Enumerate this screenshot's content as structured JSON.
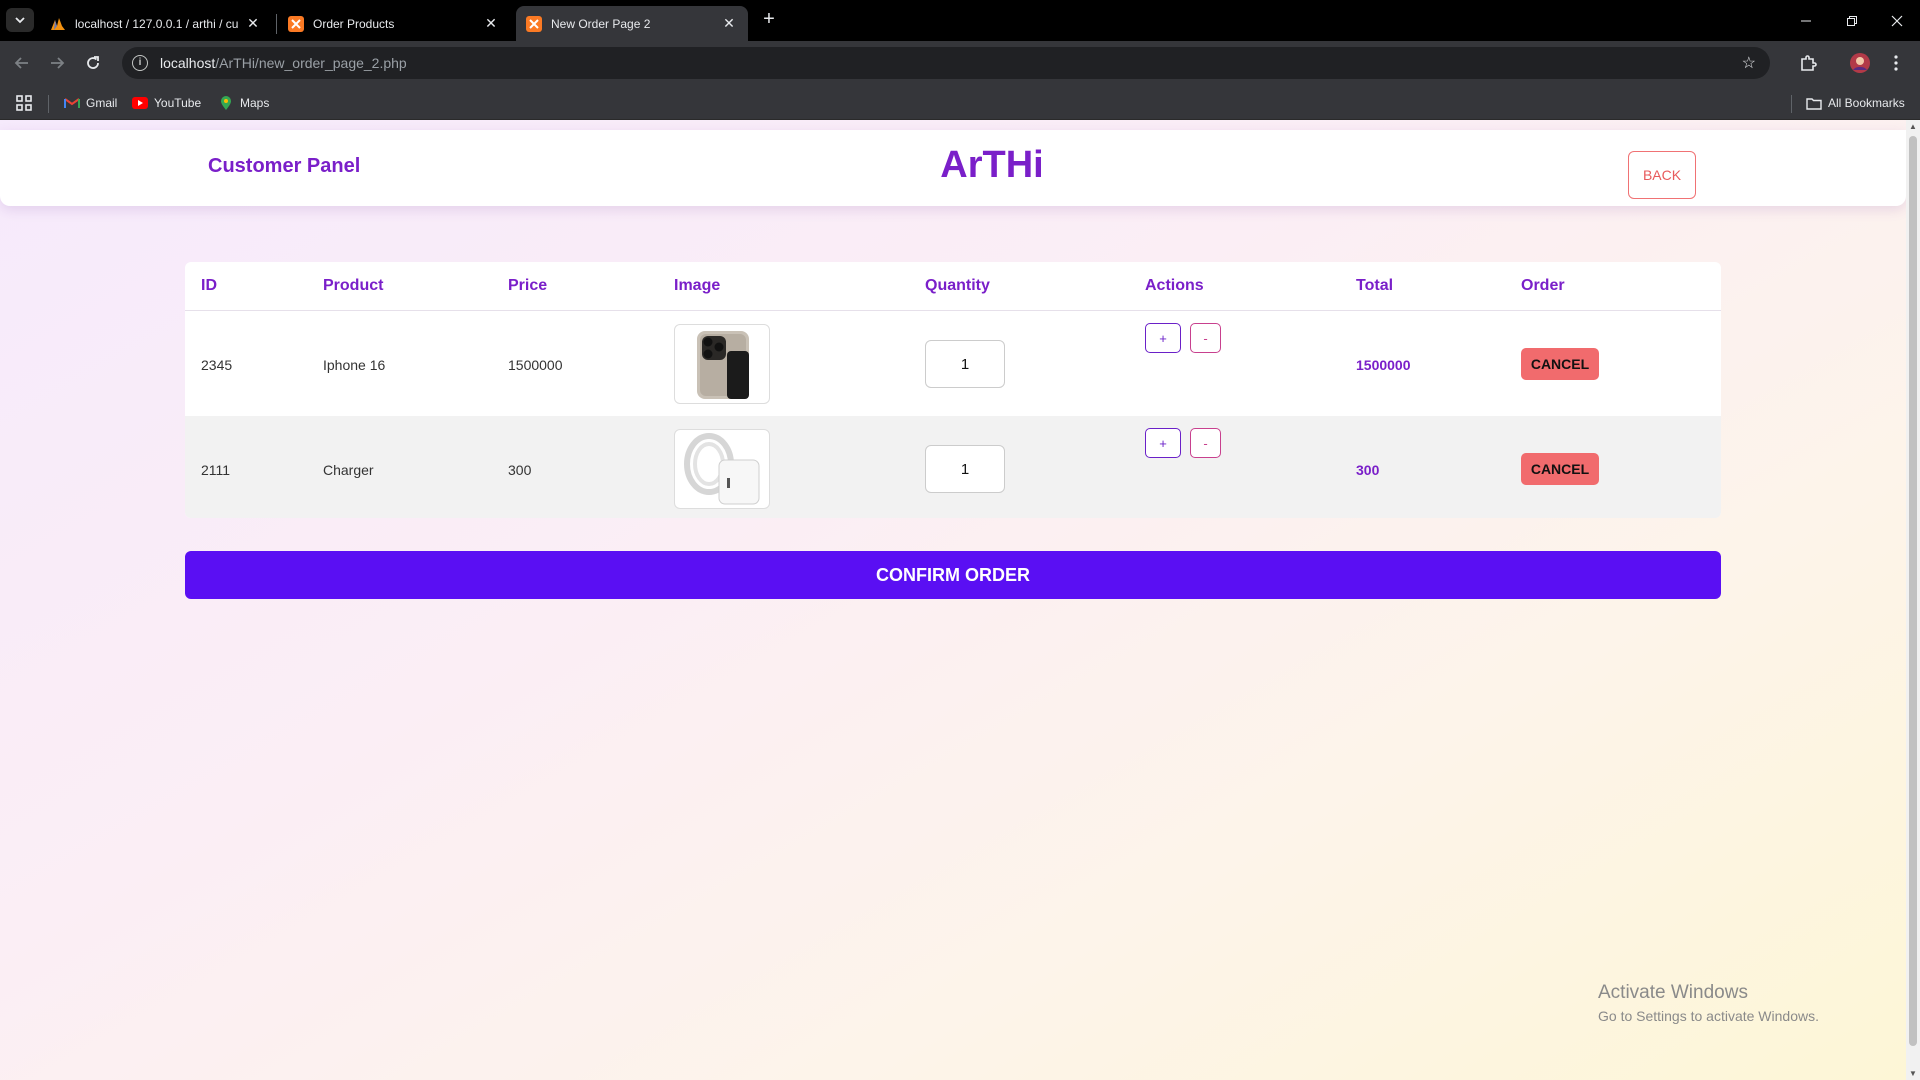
{
  "browser": {
    "tabs": [
      {
        "title": "localhost / 127.0.0.1 / arthi / cu",
        "active": false,
        "icon": "phpmyadmin-icon"
      },
      {
        "title": "Order Products",
        "active": false,
        "icon": "xampp-icon"
      },
      {
        "title": "New Order Page 2",
        "active": true,
        "icon": "xampp-icon"
      }
    ],
    "address": {
      "host": "localhost",
      "path": "/ArTHi/new_order_page_2.php"
    },
    "bookmarks": [
      {
        "label": "Gmail",
        "icon": "gmail-icon"
      },
      {
        "label": "YouTube",
        "icon": "youtube-icon"
      },
      {
        "label": "Maps",
        "icon": "maps-icon"
      }
    ],
    "all_bookmarks_label": "All Bookmarks"
  },
  "header": {
    "panel_title": "Customer Panel",
    "brand": "ArTHi",
    "back_label": "BACK"
  },
  "table": {
    "columns": [
      "ID",
      "Product",
      "Price",
      "Image",
      "Quantity",
      "Actions",
      "Total",
      "Order"
    ],
    "rows": [
      {
        "id": "2345",
        "product": "Iphone 16",
        "price": "1500000",
        "image": "iphone-image",
        "quantity": "1",
        "plus": "+",
        "minus": "-",
        "total": "1500000",
        "cancel": "CANCEL"
      },
      {
        "id": "2111",
        "product": "Charger",
        "price": "300",
        "image": "charger-image",
        "quantity": "1",
        "plus": "+",
        "minus": "-",
        "total": "300",
        "cancel": "CANCEL"
      }
    ]
  },
  "confirm_label": "CONFIRM ORDER",
  "watermark": {
    "line1": "Activate Windows",
    "line2": "Go to Settings to activate Windows."
  },
  "colors": {
    "accent": "#7a1fc9",
    "confirm": "#5a0ff3",
    "cancel": "#f16b6d"
  }
}
